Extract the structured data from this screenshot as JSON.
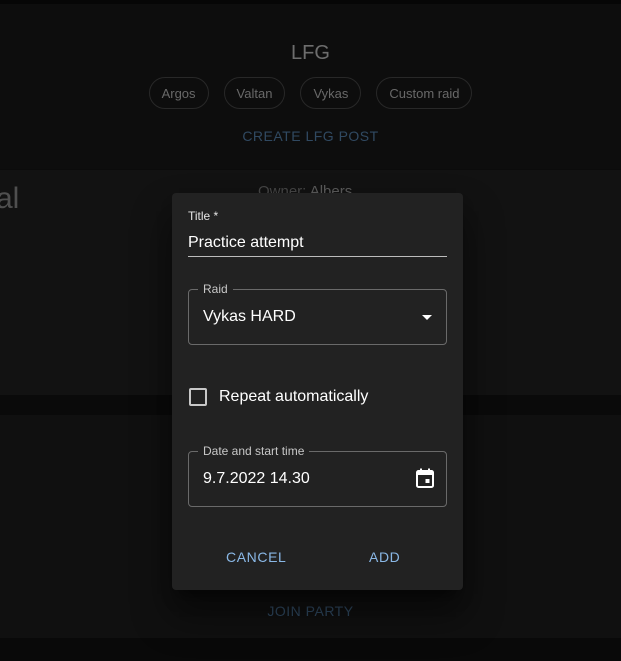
{
  "header": {
    "title": "LFG",
    "chips": [
      "Argos",
      "Valtan",
      "Vykas",
      "Custom raid"
    ],
    "create_label": "CREATE LFG POST"
  },
  "background_card": {
    "partial_title": "al",
    "owner_label": "Owner:",
    "owner_name": "Albers",
    "join_label": "JOIN PARTY"
  },
  "dialog": {
    "title_label": "Title *",
    "title_value": "Practice attempt",
    "raid_label": "Raid",
    "raid_value": "Vykas HARD",
    "repeat_label": "Repeat automatically",
    "repeat_checked": false,
    "date_label": "Date and start time",
    "date_value": "9.7.2022 14.30",
    "cancel_label": "CANCEL",
    "add_label": "ADD"
  },
  "icons": {
    "raid_dropdown": "caret-down-icon",
    "date_picker": "calendar-icon"
  },
  "colors": {
    "accent": "#8ab8e6",
    "dim_accent": "#4b7196",
    "dialog_bg": "#222222"
  }
}
